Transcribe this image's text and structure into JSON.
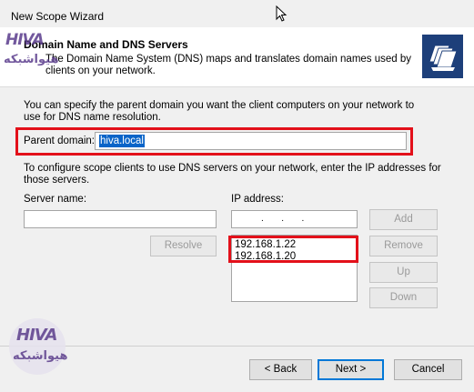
{
  "window": {
    "title": "New Scope Wizard"
  },
  "header": {
    "title": "Domain Name and DNS Servers",
    "description": "The Domain Name System (DNS) maps and translates domain names used by clients on your network."
  },
  "parent_domain": {
    "intro": "You can specify the parent domain you want the client computers on your network to use for DNS name resolution.",
    "label": "Parent domain:",
    "value": "hiva.local"
  },
  "dns": {
    "intro": "To configure scope clients to use DNS servers on your network, enter the IP addresses for those servers.",
    "server_name_label": "Server name:",
    "server_name_value": "",
    "resolve_label": "Resolve",
    "ip_label": "IP address:",
    "ip_value": ".       .       .",
    "add_label": "Add",
    "ip_list": [
      "192.168.1.22",
      "192.168.1.20"
    ],
    "remove_label": "Remove",
    "up_label": "Up",
    "down_label": "Down"
  },
  "footer": {
    "back_label": "< Back",
    "next_label": "Next >",
    "cancel_label": "Cancel"
  },
  "watermark": {
    "brand_latin": "HIVA",
    "brand_persian": "هیواشبکه"
  },
  "colors": {
    "highlight_box": "#e3101a",
    "selection": "#0a64c8",
    "brand": "#5a3c8c"
  }
}
